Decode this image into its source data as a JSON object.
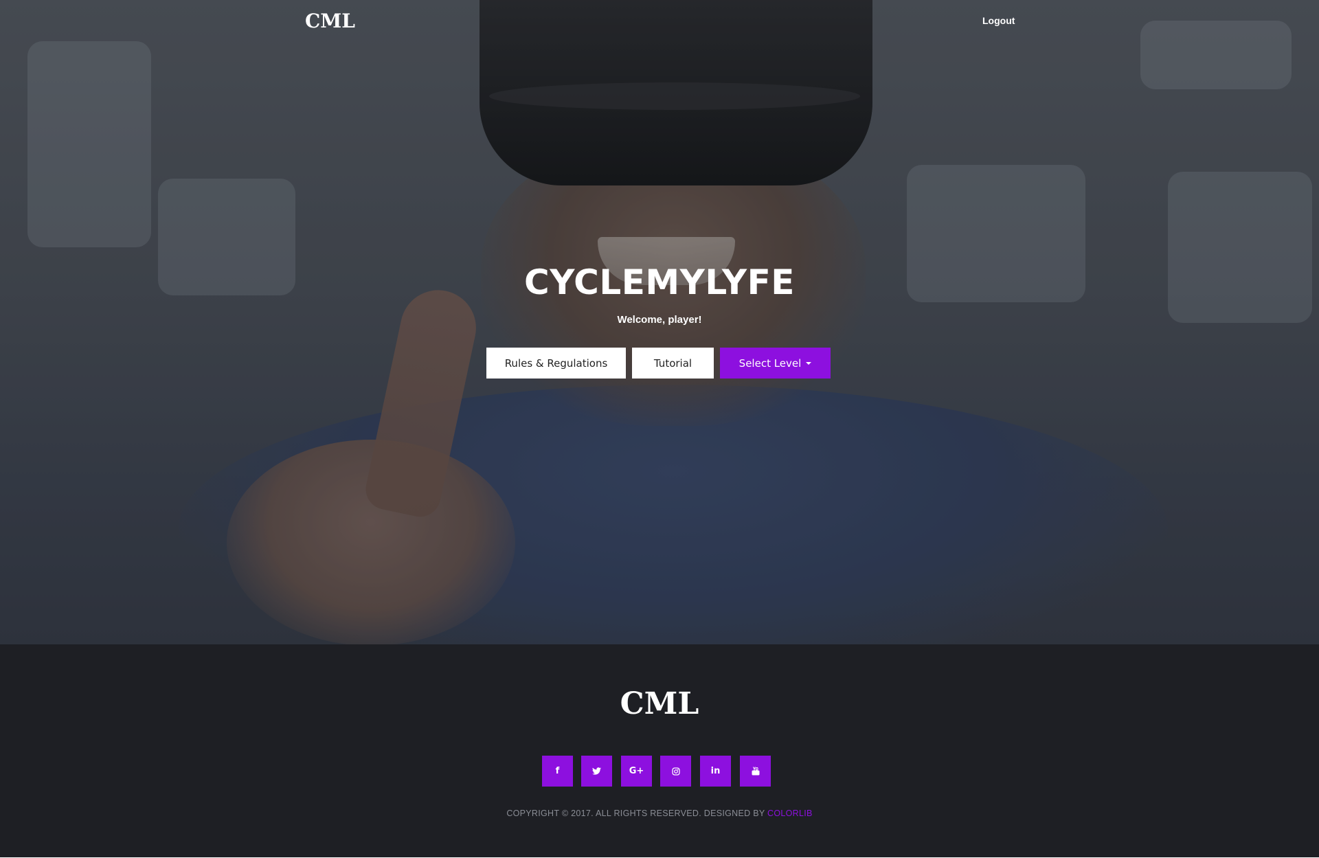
{
  "nav": {
    "logo": "CML",
    "logout_label": "Logout"
  },
  "hero": {
    "title": "CYCLEMYLYFE",
    "subtitle": "Welcome, player!",
    "buttons": {
      "rules_label": "Rules & Regulations",
      "tutorial_label": "Tutorial",
      "select_level_label": "Select Level"
    }
  },
  "footer": {
    "logo": "CML",
    "social": [
      {
        "icon": "facebook-icon",
        "glyph": "f"
      },
      {
        "icon": "twitter-icon",
        "glyph": "🐦"
      },
      {
        "icon": "google-plus-icon",
        "glyph": "G+"
      },
      {
        "icon": "instagram-icon",
        "glyph": "◎"
      },
      {
        "icon": "linkedin-icon",
        "glyph": "in"
      },
      {
        "icon": "youtube-icon",
        "glyph": "▶"
      }
    ],
    "copyright_text": "COPYRIGHT © 2017. ALL RIGHTS RESERVED. DESIGNED BY",
    "copyright_link": "COLORLIB"
  },
  "colors": {
    "accent": "#8d10df",
    "footer_bg": "#1e1f24"
  }
}
